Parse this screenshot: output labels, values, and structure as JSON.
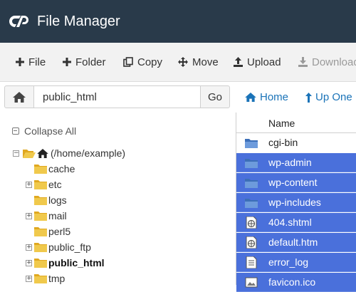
{
  "header": {
    "title": "File Manager",
    "logo_icon": "cpanel-logo-icon"
  },
  "toolbar": {
    "items": [
      {
        "label": "File",
        "icon": "plus-icon"
      },
      {
        "label": "Folder",
        "icon": "plus-icon"
      },
      {
        "label": "Copy",
        "icon": "copy-icon"
      },
      {
        "label": "Move",
        "icon": "move-icon"
      },
      {
        "label": "Upload",
        "icon": "upload-icon"
      },
      {
        "label": "Download",
        "icon": "download-icon",
        "disabled": true
      }
    ]
  },
  "pathbar": {
    "value": "public_html",
    "go_label": "Go"
  },
  "nav": {
    "home_label": "Home",
    "up_label": "Up One L"
  },
  "tree": {
    "collapse_label": "Collapse All",
    "root_label": "(/home/example)",
    "items": [
      {
        "label": "cache",
        "expandable": false
      },
      {
        "label": "etc",
        "expandable": true
      },
      {
        "label": "logs",
        "expandable": false
      },
      {
        "label": "mail",
        "expandable": true
      },
      {
        "label": "perl5",
        "expandable": false
      },
      {
        "label": "public_ftp",
        "expandable": true
      },
      {
        "label": "public_html",
        "expandable": true,
        "bold": true
      },
      {
        "label": "tmp",
        "expandable": true
      }
    ]
  },
  "file_list": {
    "column_name": "Name",
    "rows": [
      {
        "name": "cgi-bin",
        "type": "folder",
        "selected": false
      },
      {
        "name": "wp-admin",
        "type": "folder",
        "selected": true
      },
      {
        "name": "wp-content",
        "type": "folder",
        "selected": true
      },
      {
        "name": "wp-includes",
        "type": "folder",
        "selected": true
      },
      {
        "name": "404.shtml",
        "type": "web-file",
        "selected": true
      },
      {
        "name": "default.htm",
        "type": "web-file",
        "selected": true
      },
      {
        "name": "error_log",
        "type": "text-file",
        "selected": true
      },
      {
        "name": "favicon.ico",
        "type": "image-file",
        "selected": true
      }
    ]
  },
  "colors": {
    "header_bg": "#293a4a",
    "selection": "#4a70db",
    "link": "#1a73b8",
    "folder": "#f0c94c"
  }
}
